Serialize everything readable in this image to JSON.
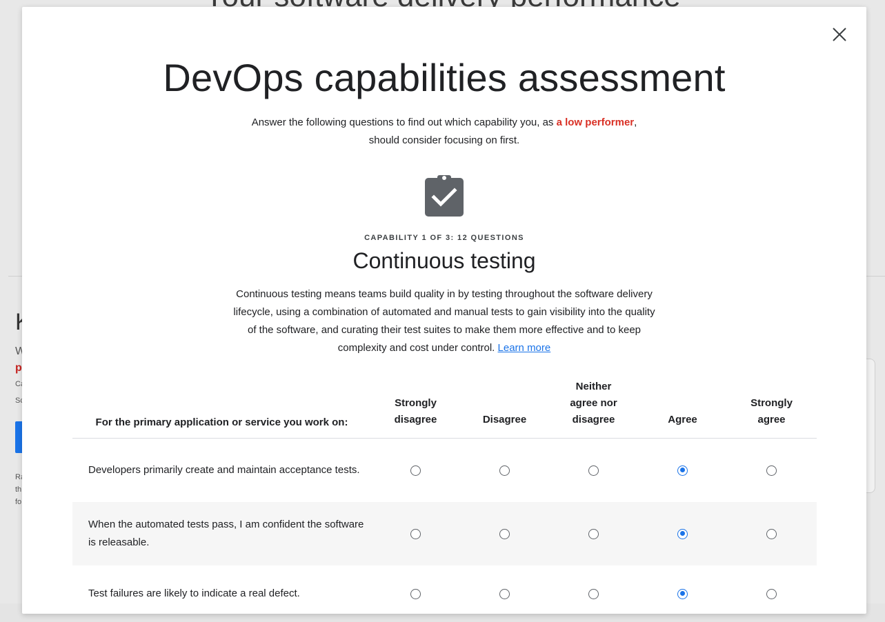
{
  "background": {
    "hero_title": "Your software delivery performance",
    "left_big": "K",
    "left_t1": "W",
    "left_t2": "p",
    "left_t3": "Ca",
    "left_t4": "Sc",
    "left_t5a": "Ra",
    "left_t5b": "th",
    "left_t5c": "fo"
  },
  "modal": {
    "title": "DevOps capabilities assessment",
    "intro_before": "Answer the following questions to find out which capability you, as ",
    "intro_highlight": "a low performer",
    "intro_after": ", should consider focusing on first.",
    "clipboard_icon": "clipboard-check-icon",
    "eyebrow": "CAPABILITY 1 OF 3: 12 QUESTIONS",
    "section_title": "Continuous testing",
    "description": "Continuous testing means teams build quality in by testing throughout the software delivery lifecycle, using a combination of automated and manual tests to gain visibility into the quality of the software, and curating their test suites to make them more effective and to keep complexity and cost under control. ",
    "learn_more": "Learn more",
    "close_icon": "close-icon"
  },
  "table": {
    "question_header": "For the primary application or service you work on:",
    "options": [
      {
        "line1": "Strongly",
        "line2": "disagree",
        "line3": ""
      },
      {
        "line1": "Disagree",
        "line2": "",
        "line3": ""
      },
      {
        "line1": "Neither",
        "line2": "agree nor",
        "line3": "disagree"
      },
      {
        "line1": "Agree",
        "line2": "",
        "line3": ""
      },
      {
        "line1": "Strongly",
        "line2": "agree",
        "line3": ""
      }
    ],
    "questions": [
      {
        "text": "Developers primarily create and maintain acceptance tests.",
        "selected": 3
      },
      {
        "text": "When the automated tests pass, I am confident the software is releasable.",
        "selected": 3
      },
      {
        "text": "Test failures are likely to indicate a real defect.",
        "selected": 3
      }
    ]
  },
  "colors": {
    "accent": "#1a73e8",
    "highlight_red": "#d93025"
  }
}
